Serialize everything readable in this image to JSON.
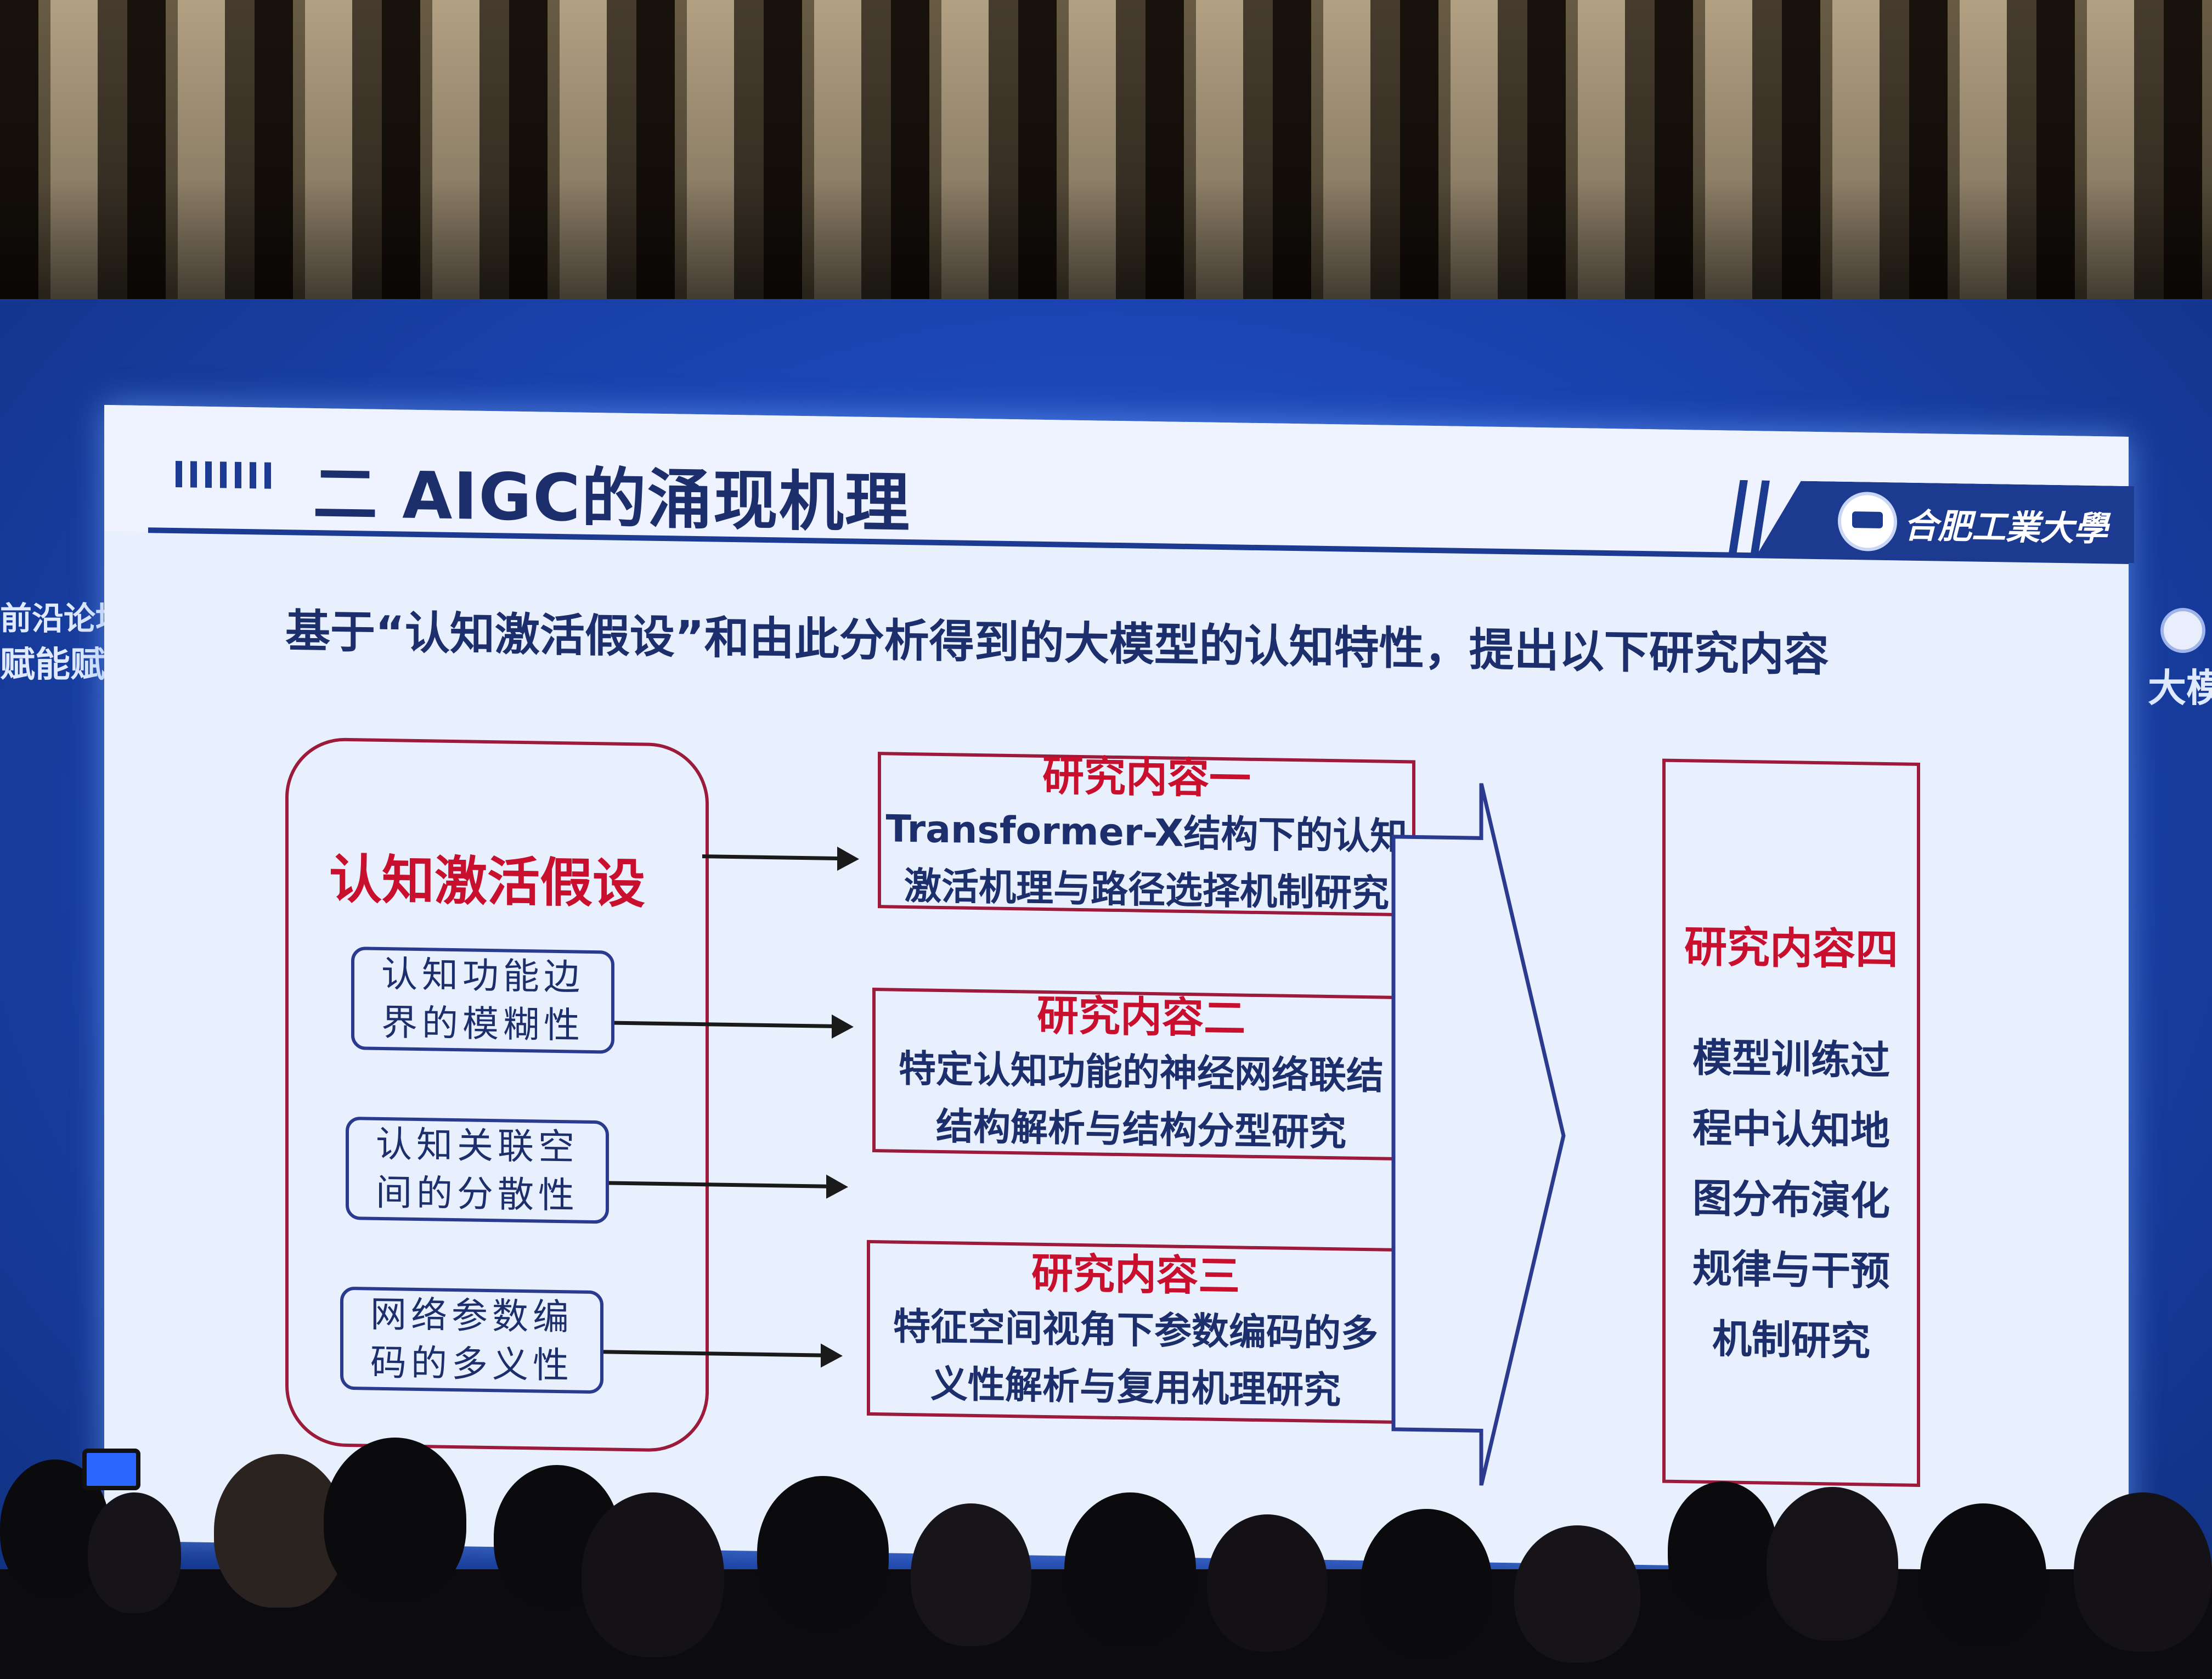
{
  "slide": {
    "title": "二 AIGC的涌现机理",
    "logo_text": "合肥工業大學",
    "subtitle": "基于“认知激活假设”和由此分析得到的大模型的认知特性，提出以下研究内容",
    "hypothesis": {
      "title": "认知激活假设",
      "properties": [
        {
          "lines": [
            "认知功能边",
            "界的模糊性"
          ]
        },
        {
          "lines": [
            "认知关联空",
            "间的分散性"
          ]
        },
        {
          "lines": [
            "网络参数编",
            "码的多义性"
          ]
        }
      ]
    },
    "research": [
      {
        "title": "研究内容一",
        "lines": [
          "Transformer-X结构下的认知",
          "激活机理与路径选择机制研究"
        ]
      },
      {
        "title": "研究内容二",
        "lines": [
          "特定认知功能的神经网络联结",
          "结构解析与结构分型研究"
        ]
      },
      {
        "title": "研究内容三",
        "lines": [
          "特征空间视角下参数编码的多",
          "义性解析与复用机理研究"
        ]
      }
    ],
    "research4": {
      "title": "研究内容四",
      "lines": [
        "模型训练过",
        "程中认知地",
        "图分布演化",
        "规律与干预",
        "机制研究"
      ]
    }
  },
  "backdrop": {
    "left_lines": [
      "前沿论坛”",
      "赋能赋智"
    ],
    "right_text": "大模"
  }
}
